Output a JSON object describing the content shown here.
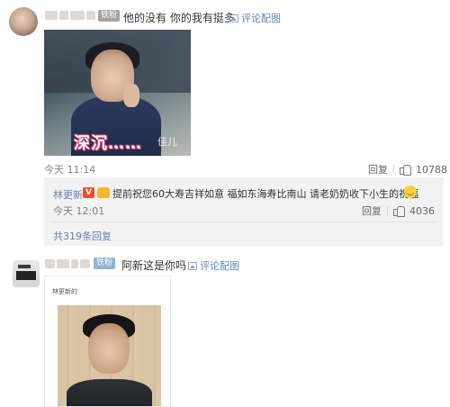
{
  "comments": [
    {
      "fan_badge": "铁粉",
      "text": "他的没有 你的我有挺多",
      "pic_link": "评论配图",
      "photo_caption": "深沉……",
      "photo_caption_small": "佳儿",
      "time": "今天 11:14",
      "reply_label": "回复",
      "like_count": "10788",
      "reply": {
        "user": "林更新",
        "text": "提前祝您60大寿吉祥如意 福如东海寿比南山  请老奶奶收下小生的祝福",
        "time": "今天 12:01",
        "reply_label": "回复",
        "like_count": "4036"
      },
      "more_replies": "共319条回复"
    },
    {
      "fan_badge": "铁粉",
      "text": "阿新这是你吗",
      "pic_link": "评论配图",
      "photo_label": "林更新的"
    }
  ],
  "icons": {
    "pic": "image-icon",
    "like": "thumb-up-icon",
    "verified": "v-badge-icon",
    "emoji": "smile-emoji-icon"
  },
  "colors": {
    "link": "#5d86b4",
    "meta": "#808080",
    "reply_bg": "#f2f2f2"
  }
}
